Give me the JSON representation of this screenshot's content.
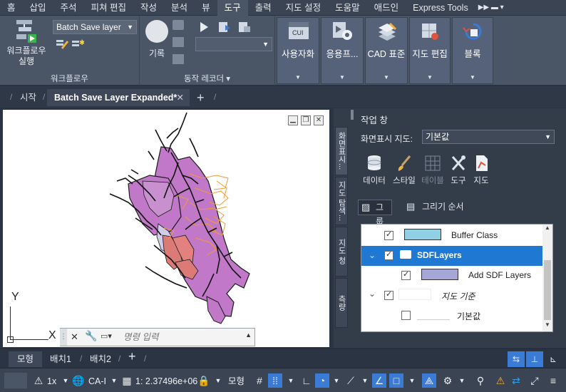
{
  "ribbon_tabs": [
    "홈",
    "삽입",
    "주석",
    "피쳐 편집",
    "작성",
    "분석",
    "뷰",
    "도구",
    "출력",
    "지도 설정",
    "도움말",
    "애드인",
    "Express Tools"
  ],
  "active_tab": "도구",
  "ribbon": {
    "workflow": {
      "run_label_1": "워크플로우",
      "run_label_2": "실행",
      "dropdown_value": "Batch Save layer",
      "panel_title": "워크플로우"
    },
    "recorder": {
      "record_label": "기록",
      "panel_title": "동작 레코더 ▾"
    },
    "tools": [
      {
        "label": "사용자화",
        "icon": "cui-icon"
      },
      {
        "label": "응용프...",
        "icon": "gear-icon"
      },
      {
        "label": "CAD 표준",
        "icon": "standards-icon"
      },
      {
        "label": "지도 편집",
        "icon": "map-edit-icon"
      },
      {
        "label": "블록",
        "icon": "block-icon"
      }
    ]
  },
  "doc_tabs": {
    "start": "시작",
    "active": "Batch Save Layer Expanded*",
    "add": "+"
  },
  "command_line": {
    "placeholder": "명령 입력"
  },
  "ucs": {
    "y": "Y",
    "x": "X"
  },
  "task_pane": {
    "title": "작업 창",
    "vertical_tabs": [
      "화면표시...",
      "지도 탐색...",
      "지도 청",
      "측량"
    ],
    "display_label": "화면표시 지도:",
    "display_value": "기본값",
    "tools": [
      {
        "label": "데이터",
        "enabled": true
      },
      {
        "label": "스타일",
        "enabled": true
      },
      {
        "label": "테이블",
        "enabled": false
      },
      {
        "label": "도구",
        "enabled": true
      },
      {
        "label": "지도",
        "enabled": true
      }
    ],
    "group_button": "그룹",
    "draw_order_button": "그리기 순서",
    "layers": [
      {
        "name": "Buffer Class",
        "checked": true,
        "swatch": "#8fd0e4",
        "selected": false,
        "expander": "",
        "folder": false
      },
      {
        "name": "SDFLayers",
        "checked": true,
        "swatch": "",
        "selected": true,
        "expander": "v",
        "folder": true
      },
      {
        "name": "Add SDF Layers",
        "checked": true,
        "swatch": "#a6a6d9",
        "selected": false,
        "expander": "",
        "folder": false
      },
      {
        "name": "지도 기준",
        "checked": true,
        "swatch": "#ffffff",
        "selected": false,
        "expander": "v",
        "folder": false
      },
      {
        "name": "기본값",
        "checked": false,
        "swatch": "#ffffff",
        "selected": false,
        "expander": "",
        "folder": false
      }
    ]
  },
  "layout_tabs": [
    "모형",
    "배치1",
    "배치2"
  ],
  "status": {
    "scale": "1x",
    "coord_system": "CA-I",
    "map_scale": "1: 2.37496e+06",
    "model": "모형"
  }
}
